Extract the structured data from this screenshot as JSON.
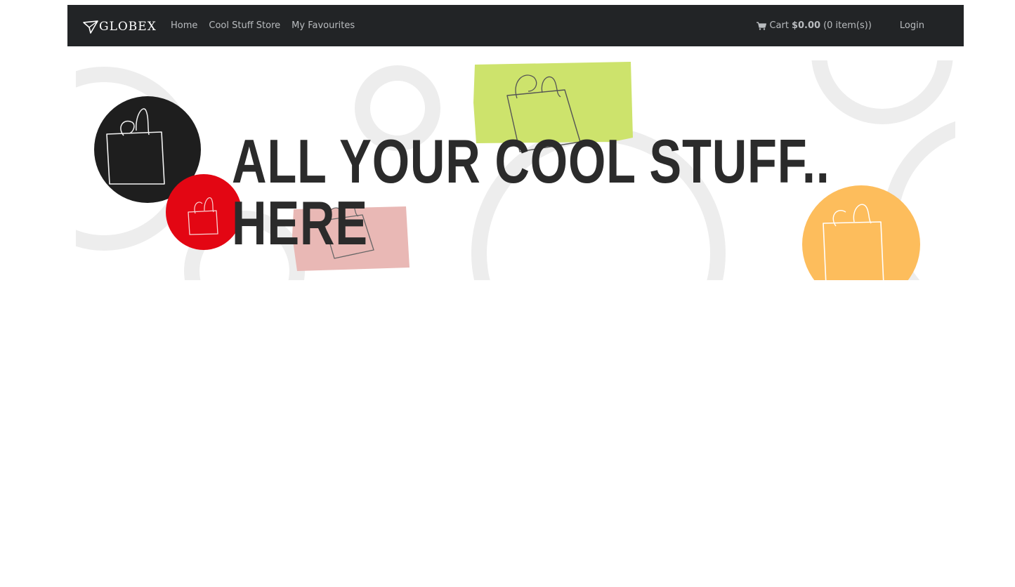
{
  "navbar": {
    "brand": {
      "text": "GLOBEX",
      "icon": "paper-plane-logo-icon"
    },
    "links": [
      {
        "label": "Home"
      },
      {
        "label": "Cool Stuff Store"
      },
      {
        "label": "My Favourites"
      }
    ],
    "cart": {
      "icon": "shopping-cart-icon",
      "label": "Cart",
      "total": "$0.00",
      "count_text": "(0 item(s))"
    },
    "login_label": "Login"
  },
  "banner": {
    "headline": "ALL YOUR COOL STUFF.. HERE",
    "colors": {
      "black": "#1e1e1e",
      "red": "#e30613",
      "green": "#cde36c",
      "pink": "#e9b8b5",
      "orange": "#fdbd5c",
      "ring": "#ededed",
      "text": "#2b2b2b"
    }
  },
  "colors": {
    "navbar_bg": "#222426",
    "nav_text": "#b9bcbf"
  }
}
